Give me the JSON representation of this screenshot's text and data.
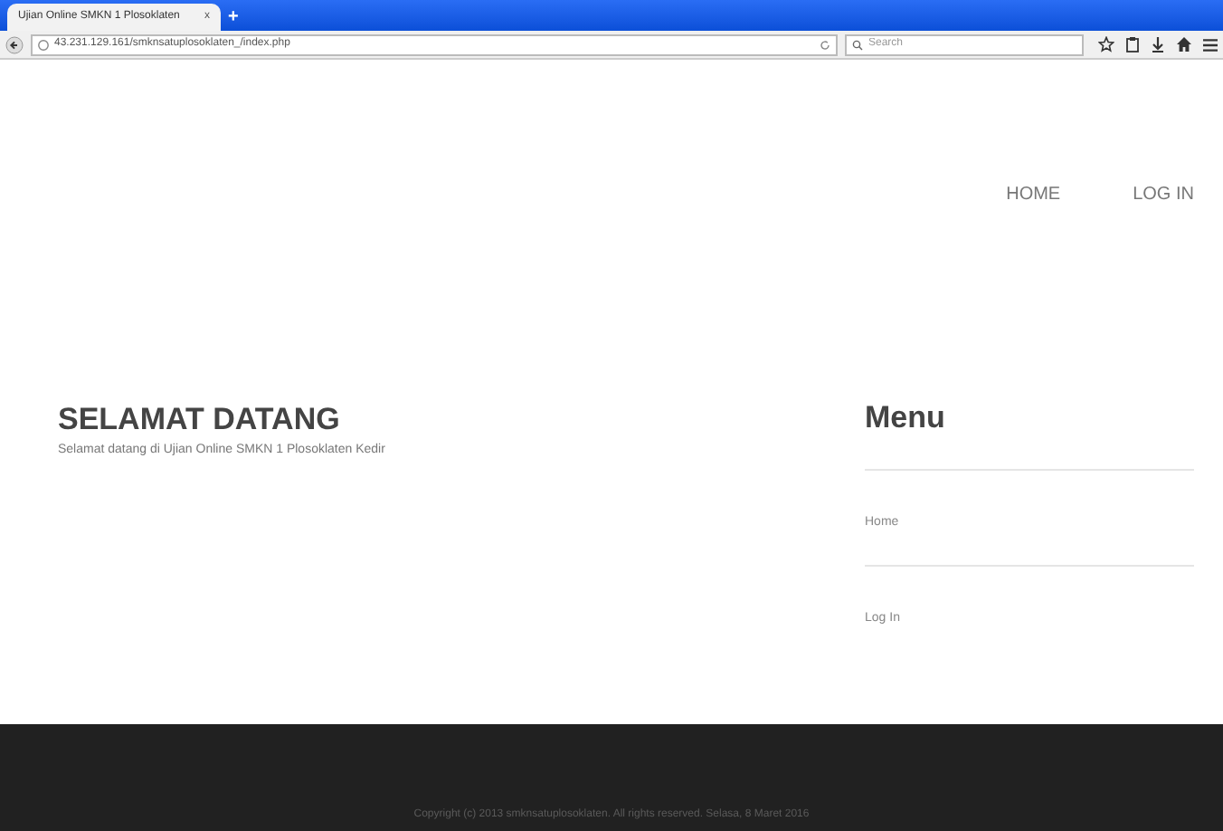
{
  "browser": {
    "tab_title": "Ujian Online SMKN 1 Plosoklaten",
    "tab_close": "x",
    "new_tab": "+",
    "url": "43.231.129.161/smknsatuplosoklaten_/index.php",
    "search_placeholder": "Search"
  },
  "nav": [
    {
      "label": "HOME"
    },
    {
      "label": "LOG IN"
    }
  ],
  "welcome": {
    "title": "SELAMAT DATANG",
    "text": "Selamat datang di Ujian Online SMKN 1 Plosoklaten Kedir"
  },
  "menu": {
    "title": "Menu",
    "items": [
      {
        "label": "Home"
      },
      {
        "label": "Log In"
      }
    ]
  },
  "footer": {
    "text": "Copyright (c) 2013 smknsatuplosoklaten. All rights reserved. Selasa, 8 Maret 2016"
  }
}
